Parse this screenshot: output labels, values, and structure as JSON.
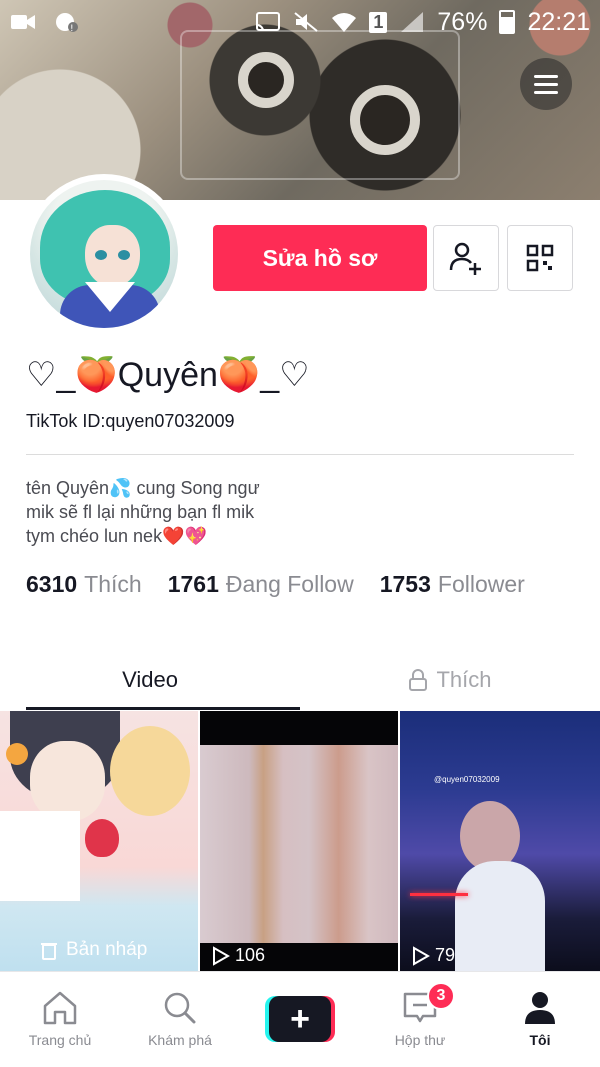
{
  "status_bar": {
    "battery": "76%",
    "time": "22:21",
    "sim": "1"
  },
  "profile": {
    "edit_label": "Sửa hồ sơ",
    "name": "♡_🍑Quyên🍑_♡",
    "tiktok_id": "TikTok ID:quyen07032009",
    "bio": [
      "tên Quyên💦 cung Song ngư",
      "mik sẽ fl lại những bạn fl mik",
      "tym chéo lun nek❤️💖"
    ]
  },
  "stats": [
    {
      "value": "6310",
      "label": "Thích"
    },
    {
      "value": "1761",
      "label": "Đang Follow"
    },
    {
      "value": "1753",
      "label": "Follower"
    }
  ],
  "tabs": {
    "video": "Video",
    "liked": "Thích"
  },
  "videos": {
    "draft_label": "Bản nháp",
    "v2_views": "106",
    "v3_views": "79",
    "v3_tag": "@quyen07032009"
  },
  "nav": {
    "home": "Trang chủ",
    "discover": "Khám phá",
    "create": "+",
    "inbox": "Hộp thư",
    "inbox_badge": "3",
    "me": "Tôi"
  },
  "colors": {
    "accent": "#fe2c55",
    "text": "#161823",
    "muted": "#8a8b91"
  }
}
